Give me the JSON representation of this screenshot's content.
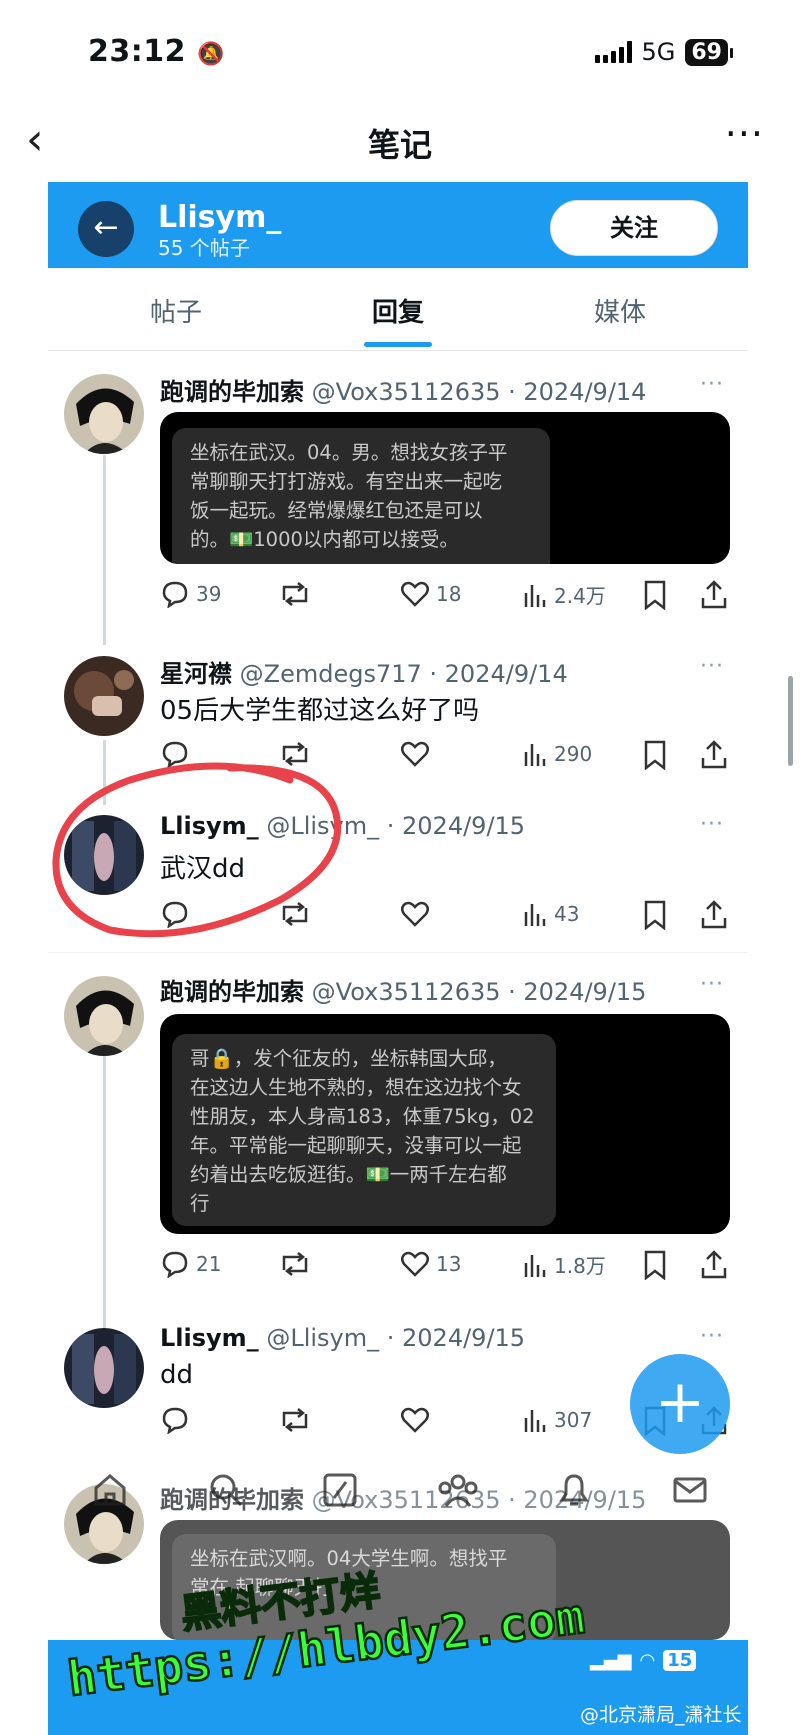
{
  "status_bar": {
    "time": "23:12",
    "network": "5G",
    "battery": "69"
  },
  "header": {
    "back": "‹",
    "title": "笔记",
    "more": "···"
  },
  "profile": {
    "name": "Llisym_",
    "post_count": "55 个帖子",
    "follow_label": "关注"
  },
  "tabs": [
    {
      "label": "帖子"
    },
    {
      "label": "回复"
    },
    {
      "label": "媒体"
    }
  ],
  "posts": [
    {
      "name": "跑调的毕加索",
      "handle_date": "@Vox35112635 · 2024/9/14",
      "image_text": "坐标在武汉。04。男。想找女孩子平常聊聊天打打游戏。有空出来一起吃饭一起玩。经常爆爆红包还是可以的。💵1000以内都可以接受。",
      "image_lines": [
        "坐标在武汉。04。男。想找女孩子平",
        "常聊聊天打打游戏。有空出来一起吃",
        "饭一起玩。经常爆爆红包还是可以",
        "的。💵1000以内都可以接受。"
      ],
      "replies": "39",
      "likes": "18",
      "views": "2.4万"
    },
    {
      "name": "星河襟",
      "handle_date": "@Zemdegs717 · 2024/9/14",
      "text": "05后大学生都过这么好了吗",
      "replies": "",
      "likes": "",
      "views": "290"
    },
    {
      "name": "Llisym_",
      "handle_date": "@Llisym_ · 2024/9/15",
      "text": "武汉dd",
      "replies": "",
      "likes": "",
      "views": "43"
    },
    {
      "name": "跑调的毕加索",
      "handle_date": "@Vox35112635 · 2024/9/15",
      "image_text": "哥🔒，发个征友的，坐标韩国大邱，在这边人生地不熟的，想在这边找个女性朋友，本人身高183，体重75kg，02年。平常能一起聊聊天，没事可以一起约着出去吃饭逛街。💵一两千左右都行",
      "image_lines": [
        "哥🔒，发个征友的，坐标韩国大邱，",
        "在这边人生地不熟的，想在这边找个女",
        "性朋友，本人身高183，体重75kg，02",
        "年。平常能一起聊聊天，没事可以一起",
        "约着出去吃饭逛街。💵一两千左右都",
        "行"
      ],
      "replies": "21",
      "likes": "13",
      "views": "1.8万"
    },
    {
      "name": "Llisym_",
      "handle_date": "@Llisym_ · 2024/9/15",
      "text": "dd",
      "replies": "",
      "likes": "",
      "views": "307"
    },
    {
      "name": "跑调的毕加索",
      "handle_date": "@Vox35112635 · 2024/9/15",
      "image_lines": [
        "坐标在武汉啊。04大学生啊。想找平",
        "常在   起聊聊天打"
      ]
    }
  ],
  "fab_label": "+",
  "watermark": {
    "line1": "黑料不打烊",
    "line2": "https://hlbdy2.com",
    "source": "@北京潇局_潇社长",
    "signal_count": "15"
  },
  "colors": {
    "accent": "#1d9bf0",
    "annotation": "#e8434b",
    "watermark": "#3cff3a"
  }
}
